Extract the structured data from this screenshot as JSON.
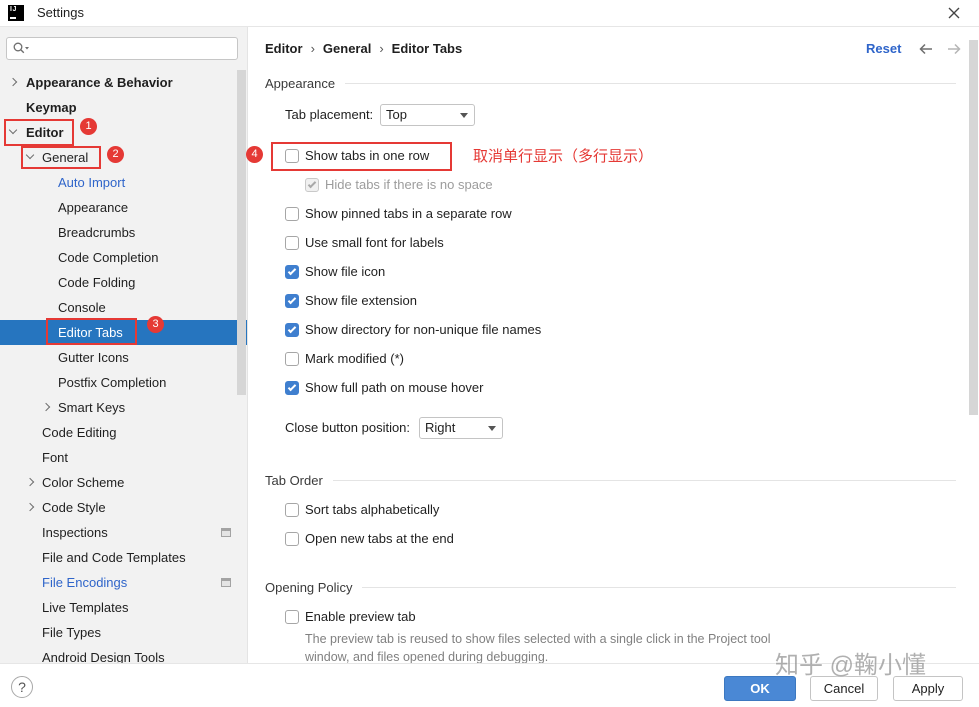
{
  "window": {
    "title": "Settings",
    "app_icon_text": "IJ"
  },
  "sidebar": {
    "items": [
      {
        "label": "Appearance & Behavior",
        "expanded": false
      },
      {
        "label": "Keymap"
      },
      {
        "label": "Editor",
        "expanded": true
      },
      {
        "label": "General",
        "expanded": true
      },
      {
        "label": "Auto Import",
        "modified": true
      },
      {
        "label": "Appearance"
      },
      {
        "label": "Breadcrumbs"
      },
      {
        "label": "Code Completion"
      },
      {
        "label": "Code Folding"
      },
      {
        "label": "Console"
      },
      {
        "label": "Editor Tabs",
        "selected": true
      },
      {
        "label": "Gutter Icons"
      },
      {
        "label": "Postfix Completion"
      },
      {
        "label": "Smart Keys",
        "expanded": false
      },
      {
        "label": "Code Editing"
      },
      {
        "label": "Font"
      },
      {
        "label": "Color Scheme",
        "expanded": false
      },
      {
        "label": "Code Style",
        "expanded": false
      },
      {
        "label": "Inspections",
        "project_scoped": true
      },
      {
        "label": "File and Code Templates"
      },
      {
        "label": "File Encodings",
        "modified": true,
        "project_scoped": true
      },
      {
        "label": "Live Templates"
      },
      {
        "label": "File Types"
      },
      {
        "label": "Android Design Tools"
      }
    ]
  },
  "annotations": {
    "step1": "1",
    "step2": "2",
    "step3": "3",
    "step4": "4",
    "note": "取消单行显示（多行显示）"
  },
  "header": {
    "breadcrumb": [
      "Editor",
      "General",
      "Editor Tabs"
    ],
    "separator": "›",
    "reset_label": "Reset"
  },
  "appearance": {
    "title": "Appearance",
    "tab_placement": {
      "label": "Tab placement:",
      "value": "Top"
    },
    "options": [
      {
        "label": "Show tabs in one row",
        "checked": false
      },
      {
        "label": "Hide tabs if there is no space",
        "checked": true,
        "disabled": true
      },
      {
        "label": "Show pinned tabs in a separate row",
        "checked": false
      },
      {
        "label": "Use small font for labels",
        "checked": false
      },
      {
        "label": "Show file icon",
        "checked": true
      },
      {
        "label": "Show file extension",
        "checked": true
      },
      {
        "label": "Show directory for non-unique file names",
        "checked": true
      },
      {
        "label": "Mark modified (*)",
        "checked": false
      },
      {
        "label": "Show full path on mouse hover",
        "checked": true
      }
    ],
    "close_button_position": {
      "label": "Close button position:",
      "value": "Right"
    }
  },
  "tab_order": {
    "title": "Tab Order",
    "options": [
      {
        "label": "Sort tabs alphabetically",
        "checked": false
      },
      {
        "label": "Open new tabs at the end",
        "checked": false
      }
    ]
  },
  "opening_policy": {
    "title": "Opening Policy",
    "options": [
      {
        "label": "Enable preview tab",
        "checked": false
      }
    ],
    "description": "The preview tab is reused to show files selected with a single click in the Project tool window, and files opened during debugging."
  },
  "footer": {
    "help_label": "?",
    "ok_label": "OK",
    "cancel_label": "Cancel",
    "apply_label": "Apply"
  },
  "watermark": "知乎 @鞠小懂",
  "colors": {
    "selection": "#2675bf",
    "link": "#2f65ca",
    "annotation": "#e53935",
    "checkbox": "#3f7fcf",
    "primary_button": "#4a88d5"
  },
  "icons": {
    "app": "intellij-logo-icon",
    "close": "close-icon",
    "search": "search-icon",
    "back": "back-arrow-icon",
    "forward": "forward-arrow-icon",
    "help": "help-icon",
    "dropdown": "dropdown-arrow-icon"
  }
}
